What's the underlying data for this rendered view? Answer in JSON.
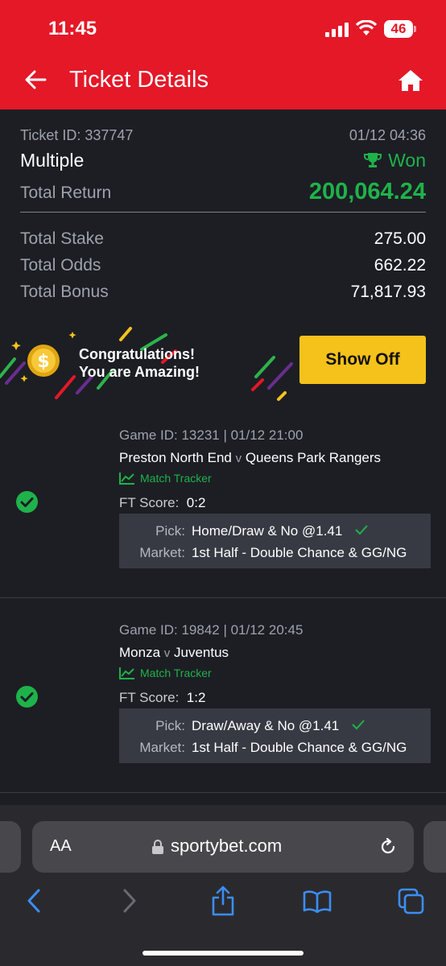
{
  "status": {
    "time": "11:45",
    "battery": "46"
  },
  "header": {
    "title": "Ticket Details"
  },
  "ticket": {
    "id_label": "Ticket ID: 337747",
    "datetime": "01/12 04:36",
    "type": "Multiple",
    "status": "Won",
    "total_return_label": "Total Return",
    "total_return": "200,064.24",
    "total_stake_label": "Total Stake",
    "total_stake": "275.00",
    "total_odds_label": "Total Odds",
    "total_odds": "662.22",
    "total_bonus_label": "Total Bonus",
    "total_bonus": "71,817.93"
  },
  "promo": {
    "line1": "Congratulations!",
    "line2": "You are Amazing!",
    "button": "Show Off"
  },
  "games": [
    {
      "meta": "Game ID: 13231 | 01/12 21:00",
      "home": "Preston North End",
      "vs": "v",
      "away": "Queens Park Rangers",
      "tracker": "Match Tracker",
      "ft_label": "FT Score:",
      "ft_score": "0:2",
      "pick_label": "Pick:",
      "pick": "Home/Draw & No @1.41",
      "market_label": "Market:",
      "market": "1st Half - Double Chance & GG/NG"
    },
    {
      "meta": "Game ID: 19842 | 01/12 20:45",
      "home": "Monza",
      "vs": "v",
      "away": "Juventus",
      "tracker": "Match Tracker",
      "ft_label": "FT Score:",
      "ft_score": "1:2",
      "pick_label": "Pick:",
      "pick": "Draw/Away & No @1.41",
      "market_label": "Market:",
      "market": "1st Half - Double Chance & GG/NG"
    }
  ],
  "browser": {
    "aa": "AA",
    "url": "sportybet.com"
  },
  "colors": {
    "brand": "#e41827",
    "won": "#1fb24a",
    "button": "#f5c21b",
    "background": "#1c1e24"
  }
}
